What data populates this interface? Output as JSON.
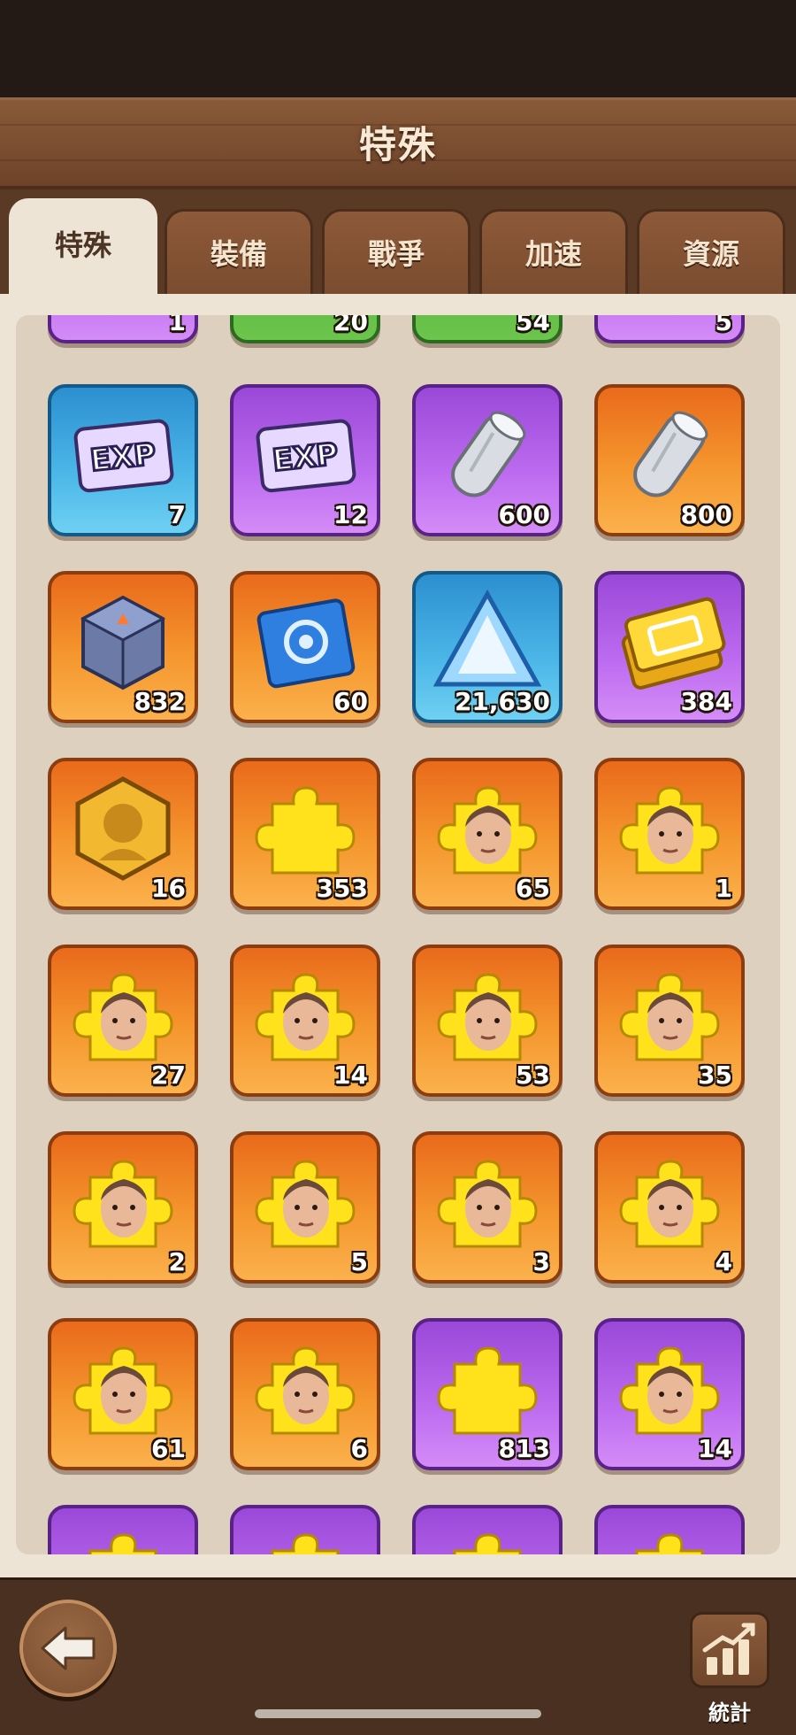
{
  "header": {
    "title": "特殊"
  },
  "tabs": [
    {
      "label": "特殊",
      "active": true
    },
    {
      "label": "裝備",
      "active": false
    },
    {
      "label": "戰爭",
      "active": false
    },
    {
      "label": "加速",
      "active": false
    },
    {
      "label": "資源",
      "active": false
    }
  ],
  "inventory": {
    "partial_top_row": [
      {
        "count": "1",
        "color": "purple"
      },
      {
        "count": "20",
        "color": "green"
      },
      {
        "count": "54",
        "color": "green"
      },
      {
        "count": "5",
        "color": "purple"
      }
    ],
    "items": [
      {
        "icon": "exp-ticket-icon",
        "count": "7",
        "color": "blue",
        "icon_text": "EXP"
      },
      {
        "icon": "exp-ticket-icon",
        "count": "12",
        "color": "purple",
        "icon_text": "EXP"
      },
      {
        "icon": "metal-rod-icon",
        "count": "600",
        "color": "purple"
      },
      {
        "icon": "metal-rod-icon",
        "count": "800",
        "color": "orange"
      },
      {
        "icon": "tech-cube-icon",
        "count": "832",
        "color": "orange"
      },
      {
        "icon": "blueprint-scroll-icon",
        "count": "60",
        "color": "orange"
      },
      {
        "icon": "crystal-triangle-icon",
        "count": "21,630",
        "color": "blue"
      },
      {
        "icon": "gold-bar-icon",
        "count": "384",
        "color": "purple"
      },
      {
        "icon": "hero-medal-icon",
        "count": "16",
        "color": "orange"
      },
      {
        "icon": "puzzle-piece-icon",
        "count": "353",
        "color": "orange"
      },
      {
        "icon": "hero-shard-icon",
        "count": "65",
        "color": "orange"
      },
      {
        "icon": "hero-shard-icon",
        "count": "1",
        "color": "orange"
      },
      {
        "icon": "hero-shard-icon",
        "count": "27",
        "color": "orange"
      },
      {
        "icon": "hero-shard-icon",
        "count": "14",
        "color": "orange"
      },
      {
        "icon": "hero-shard-icon",
        "count": "53",
        "color": "orange"
      },
      {
        "icon": "hero-shard-icon",
        "count": "35",
        "color": "orange"
      },
      {
        "icon": "hero-shard-icon",
        "count": "2",
        "color": "orange"
      },
      {
        "icon": "hero-shard-icon",
        "count": "5",
        "color": "orange"
      },
      {
        "icon": "hero-shard-icon",
        "count": "3",
        "color": "orange"
      },
      {
        "icon": "hero-shard-icon",
        "count": "4",
        "color": "orange"
      },
      {
        "icon": "hero-shard-icon",
        "count": "61",
        "color": "orange"
      },
      {
        "icon": "hero-shard-icon",
        "count": "6",
        "color": "orange"
      },
      {
        "icon": "puzzle-piece-icon",
        "count": "813",
        "color": "purple"
      },
      {
        "icon": "hero-shard-icon",
        "count": "14",
        "color": "purple"
      }
    ],
    "partial_bottom_row": [
      {
        "color": "purple"
      },
      {
        "color": "purple"
      },
      {
        "color": "purple"
      },
      {
        "color": "purple"
      }
    ]
  },
  "footer": {
    "back_icon": "back-arrow-icon",
    "stats_icon": "bar-chart-icon",
    "stats_label": "統計"
  }
}
